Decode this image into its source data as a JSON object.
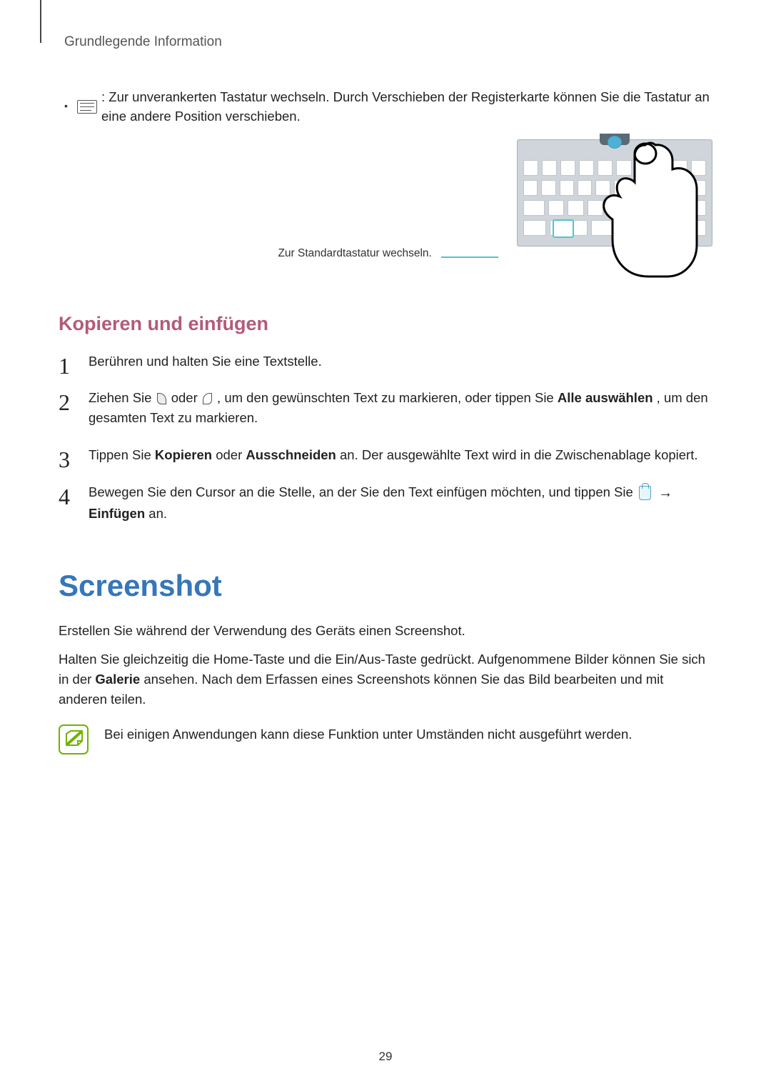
{
  "header": {
    "section": "Grundlegende Information"
  },
  "floatingKbd": {
    "text": ": Zur unverankerten Tastatur wechseln. Durch Verschieben der Registerkarte können Sie die Tastatur an eine andere Position verschieben.",
    "caption": "Zur Standardtastatur wechseln."
  },
  "copyPaste": {
    "heading": "Kopieren und einfügen",
    "step1": "Berühren und halten Sie eine Textstelle.",
    "step2_a": "Ziehen Sie ",
    "step2_b": " oder ",
    "step2_c": ", um den gewünschten Text zu markieren, oder tippen Sie ",
    "step2_bold": "Alle auswählen",
    "step2_d": ", um den gesamten Text zu markieren.",
    "step3_a": "Tippen Sie ",
    "step3_b1": "Kopieren",
    "step3_c": " oder ",
    "step3_b2": "Ausschneiden",
    "step3_d": " an. Der ausgewählte Text wird in die Zwischenablage kopiert.",
    "step4_a": "Bewegen Sie den Cursor an die Stelle, an der Sie den Text einfügen möchten, und tippen Sie ",
    "step4_b": "Einfügen",
    "step4_c": " an."
  },
  "screenshot": {
    "heading": "Screenshot",
    "intro": "Erstellen Sie während der Verwendung des Geräts einen Screenshot.",
    "body_a": "Halten Sie gleichzeitig die Home-Taste und die Ein/Aus-Taste gedrückt. Aufgenommene Bilder können Sie sich in der ",
    "body_bold": "Galerie",
    "body_b": " ansehen. Nach dem Erfassen eines Screenshots können Sie das Bild bearbeiten und mit anderen teilen.",
    "note": "Bei einigen Anwendungen kann diese Funktion unter Umständen nicht ausgeführt werden."
  },
  "pageNumber": "29"
}
